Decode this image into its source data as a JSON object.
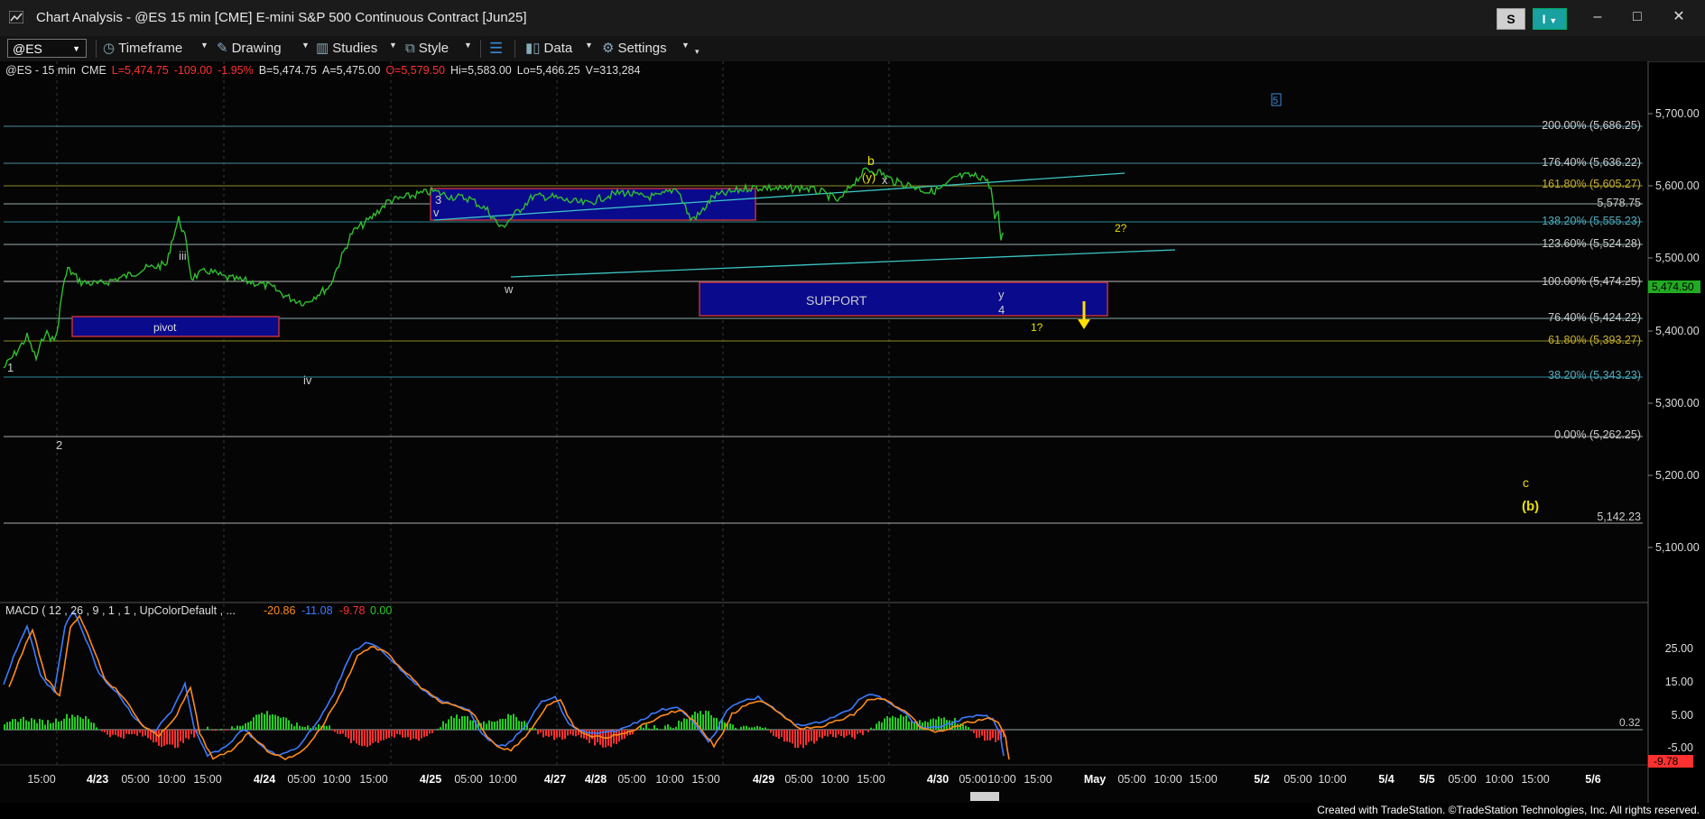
{
  "window": {
    "title": "Chart Analysis - @ES 15 min [CME] E-mini S&P 500 Continuous Contract [Jun25]",
    "s_button": "S",
    "i_button": "I",
    "minimize": "–",
    "maximize": "□",
    "close": "✕"
  },
  "toolbar": {
    "symbol": "@ES",
    "timeframe": "Timeframe",
    "drawing": "Drawing",
    "studies": "Studies",
    "style": "Style",
    "data": "Data",
    "settings": "Settings"
  },
  "legend": {
    "symbol": "@ES - 15 min",
    "exchange": "CME",
    "last": "L=5,474.75",
    "change": "-109.00",
    "pct": "-1.95%",
    "bid": "B=5,474.75",
    "ask": "A=5,475.00",
    "open": "O=5,579.50",
    "high": "Hi=5,583.00",
    "low": "Lo=5,466.25",
    "volume": "V=313,284"
  },
  "macd_legend": {
    "label": "MACD ( 12 , 26 , 9 , 1 , 1 , UpColorDefault , ...",
    "v1": "-20.86",
    "v2": "-11.08",
    "v3": "-9.78",
    "v4": "0.00"
  },
  "price_axis": [
    "5,700.00",
    "5,600.00",
    "5,500.00",
    "5,400.00",
    "5,300.00",
    "5,200.00",
    "5,100.00"
  ],
  "current_price": "5,474.50",
  "macd_axis": [
    "25.00",
    "15.00",
    "5.00",
    "-5.00"
  ],
  "macd_current": "-9.78",
  "fib_labels": [
    "200.00% (5,686.25)",
    "176.40% (5,636.22)",
    "161.80% (5,605.27)",
    "5,578.75",
    "138.20% (5,555.23)",
    "123.60% (5,524.28)",
    "100.00% (5,474.25)",
    "76.40% (5,424.22)",
    "61.80% (5,393.27)",
    "38.20% (5,343.23)",
    "0.00% (5,262.25)",
    "5,142.23"
  ],
  "macd_line_label": "0.32",
  "wave_labels": {
    "w1": "1",
    "w2": "2",
    "w3": "iii",
    "w4": "iv",
    "box3": "3",
    "v": "v",
    "w": "w",
    "b": "b",
    "y_paren": "(y)",
    "x": "x",
    "y": "y",
    "four": "4",
    "one_q": "1?",
    "two_q": "2?",
    "five": "5",
    "c": "c",
    "b_paren": "(b)"
  },
  "zones": {
    "pivot": "pivot",
    "support": "SUPPORT"
  },
  "time_axis": [
    "15:00",
    "4/23",
    "05:00",
    "10:00",
    "15:00",
    "4/24",
    "05:00",
    "10:00",
    "15:00",
    "4/25",
    "05:00",
    "10:00",
    "4/27",
    "4/28",
    "05:00",
    "10:00",
    "15:00",
    "4/29",
    "05:00",
    "10:00",
    "15:00",
    "4/30",
    "05:00",
    "10:00",
    "15:00",
    "May",
    "05:00",
    "10:00",
    "15:00",
    "5/2",
    "05:00",
    "10:00",
    "5/4",
    "5/5",
    "05:00",
    "10:00",
    "15:00",
    "5/6"
  ],
  "footer": "Created with TradeStation. ©TradeStation Technologies, Inc. All rights reserved.",
  "colors": {
    "up": "#22cc22",
    "down": "#ff3030",
    "fib_line": "#4a8a9a",
    "zone_fill": "#0a0a8c",
    "wave_yellow": "#e8e000",
    "macd_blue": "#3b7bff",
    "macd_orange": "#ff8a1a"
  }
}
